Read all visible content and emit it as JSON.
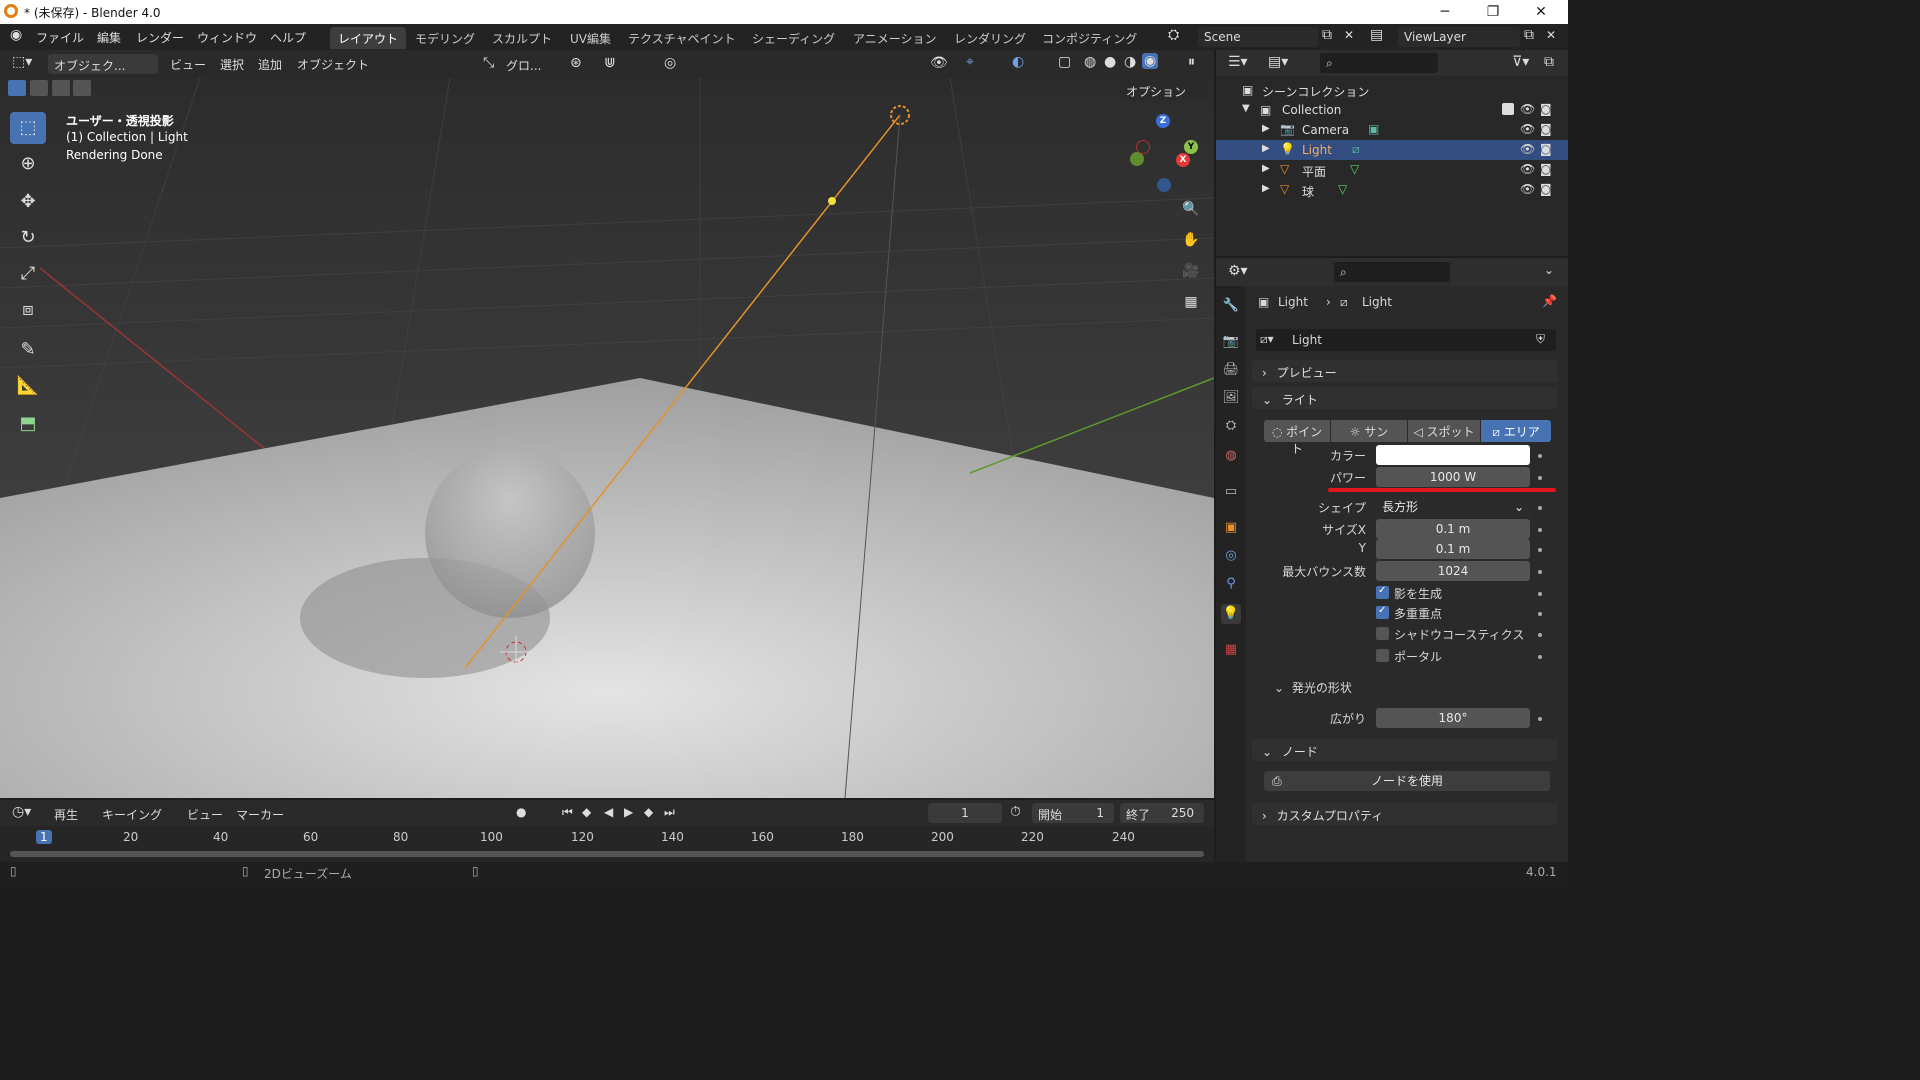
{
  "window": {
    "title": "* (未保存) - Blender 4.0",
    "minimize": "─",
    "maximize": "❐",
    "close": "✕"
  },
  "topbar": {
    "menus": [
      "ファイル",
      "編集",
      "レンダー",
      "ウィンドウ",
      "ヘルプ"
    ],
    "workspaces": [
      "レイアウト",
      "モデリング",
      "スカルプト",
      "UV編集",
      "テクスチャペイント",
      "シェーディング",
      "アニメーション",
      "レンダリング",
      "コンポジティング"
    ],
    "active_workspace": 0,
    "scene": "Scene",
    "view_layer": "ViewLayer"
  },
  "viewport": {
    "mode": "オブジェク...",
    "menus": [
      "ビュー",
      "選択",
      "追加",
      "オブジェクト"
    ],
    "transform": "グロ...",
    "options": "オプション",
    "overlay_lines": [
      "ユーザー・透視投影",
      "(1) Collection | Light",
      "Rendering Done"
    ],
    "gizmo": {
      "x": "X",
      "y": "Y",
      "z": "Z"
    }
  },
  "timeline": {
    "menus": [
      "再生",
      "キーイング",
      "ビュー",
      "マーカー"
    ],
    "current_frame": "1",
    "start_label": "開始",
    "start": "1",
    "end_label": "終了",
    "end": "250",
    "ticks": [
      "1",
      "20",
      "40",
      "60",
      "80",
      "100",
      "120",
      "140",
      "160",
      "180",
      "200",
      "220",
      "240"
    ]
  },
  "statusbar": {
    "hint": "2Dビューズーム",
    "version": "4.0.1"
  },
  "outliner": {
    "root": "シーンコレクション",
    "collection": "Collection",
    "items": [
      {
        "name": "Camera",
        "selected": false
      },
      {
        "name": "Light",
        "selected": true
      },
      {
        "name": "平面",
        "selected": false
      },
      {
        "name": "球",
        "selected": false
      }
    ]
  },
  "properties": {
    "breadcrumb": [
      "Light",
      "Light"
    ],
    "datablock": "Light",
    "sections": {
      "preview": "プレビュー",
      "light": "ライト",
      "emission": "発光の形状",
      "nodes": "ノード",
      "custom": "カスタムプロパティ"
    },
    "light_types": [
      "ポイント",
      "サン",
      "スポット",
      "エリア"
    ],
    "active_type": 3,
    "color_label": "カラー",
    "color": "#ffffff",
    "power_label": "パワー",
    "power": "1000 W",
    "shape_label": "シェイプ",
    "shape": "長方形",
    "size_x_label": "サイズX",
    "size_x": "0.1 m",
    "size_y_label": "Y",
    "size_y": "0.1 m",
    "bounces_label": "最大バウンス数",
    "bounces": "1024",
    "checks": [
      {
        "label": "影を生成",
        "on": true
      },
      {
        "label": "多重重点",
        "on": true
      },
      {
        "label": "シャドウコースティクス",
        "on": false
      },
      {
        "label": "ポータル",
        "on": false
      }
    ],
    "spread_label": "広がり",
    "spread": "180°",
    "use_nodes": "ノードを使用"
  },
  "colors": {
    "accent": "#4772b3",
    "light_line": "#e8902a",
    "highlight": "#e0181e"
  }
}
